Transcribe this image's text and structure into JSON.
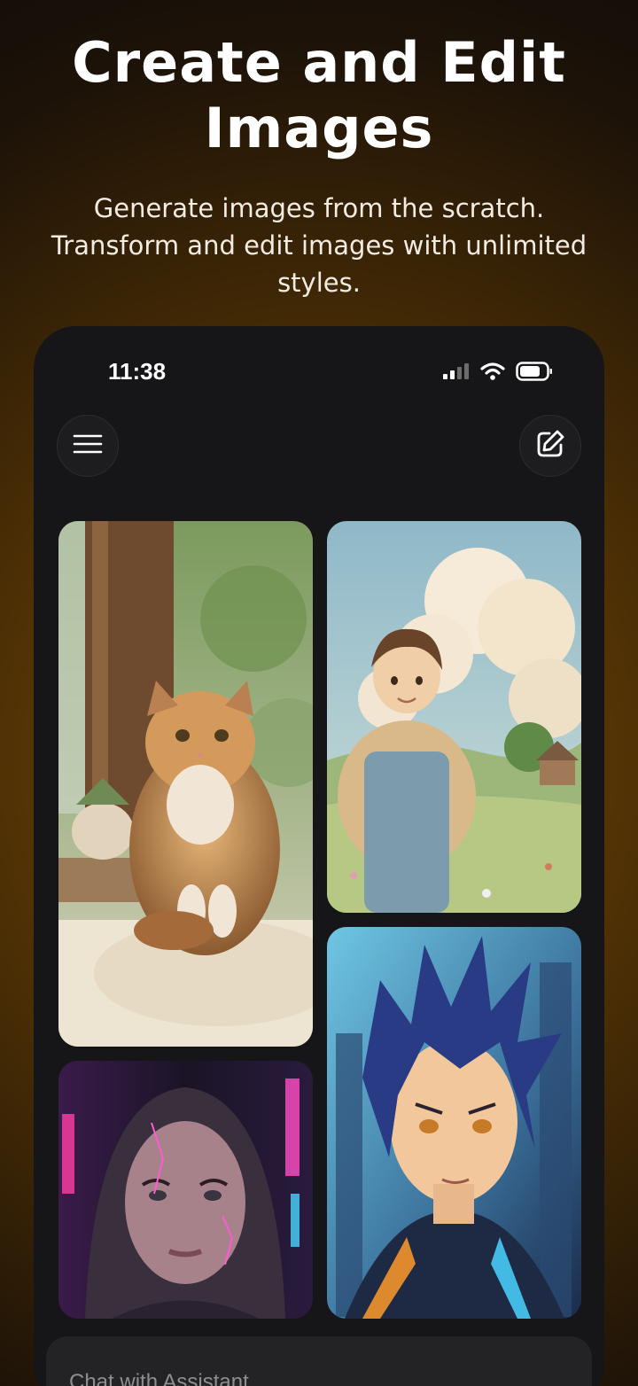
{
  "promo": {
    "headline": "Create and Edit Images",
    "subline": "Generate images from the scratch. Transform and edit images with unlimited styles."
  },
  "status_bar": {
    "time": "11:38",
    "icons": [
      "signal-icon",
      "wifi-icon",
      "battery-icon"
    ]
  },
  "toolbar": {
    "menu_icon": "hamburger-menu-icon",
    "new_chat_icon": "edit-icon"
  },
  "gallery": {
    "images": [
      {
        "name": "calico-cat-photo"
      },
      {
        "name": "watercolor-farm-boy"
      },
      {
        "name": "anime-hero-portrait"
      },
      {
        "name": "cyberpunk-hooded-woman"
      }
    ]
  },
  "chat": {
    "placeholder": "Chat with Assistant"
  },
  "colors": {
    "background_glow": "#7a4e08",
    "phone_bg": "#161618",
    "chat_bar_bg": "#232326"
  }
}
